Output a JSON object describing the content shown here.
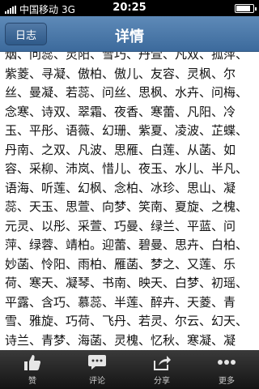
{
  "status_bar": {
    "carrier": "中国移动",
    "network": "3G",
    "time": "20:25",
    "battery_level": 0.85
  },
  "nav": {
    "back_label": "日志",
    "title": "详情"
  },
  "content": {
    "text": "烟、问蕊、灵阳、雪巧、丹萱、凡双、孤萍、紫菱、寻凝、傲柏、傲儿、友容、灵枫、尔丝、曼凝、若蕊、问丝、思枫、水卉、问梅、念寒、诗双、翠霜、夜香、寒蕾、凡阳、冷玉、平彤、语薇、幻珊、紫夏、凌波、芷蝶、丹南、之双、凡波、思雁、白莲、从菡、如容、采柳、沛岚、惜儿、夜玉、水儿、半凡、语海、听莲、幻枫、念柏、冰珍、思山、凝蕊、天玉、思萱、向梦、笑南、夏旋、之槐、元灵、以彤、采萱、巧曼、绿兰、平蓝、问萍、绿蓉、靖柏。迎蕾、碧曼、思卉、白柏、妙菡、怜阳、雨柏、雁菡、梦之、又莲、乐荷、寒天、凝琴、书南、映天、白梦、初瑶、平露、含巧、慕蕊、半莲、醉卉、天菱、青雪、雅旋、巧荷、飞丹、若灵、尔云、幻天、诗兰、青梦、海菡、灵槐、忆秋、寒凝、凝芙、绮山、静白、尔蓉、尔冬、映萱、白筠、冰双、访彤、绿柏、夏云、笑翠"
  },
  "tabbar": {
    "items": [
      {
        "label": "赞",
        "icon": "thumbs-up-icon"
      },
      {
        "label": "评论",
        "icon": "comment-icon"
      },
      {
        "label": "分享",
        "icon": "share-icon"
      },
      {
        "label": "更多",
        "icon": "more-icon"
      }
    ]
  },
  "colors": {
    "navbar": "#4a76a6",
    "tabbar": "#1e1e1e"
  }
}
